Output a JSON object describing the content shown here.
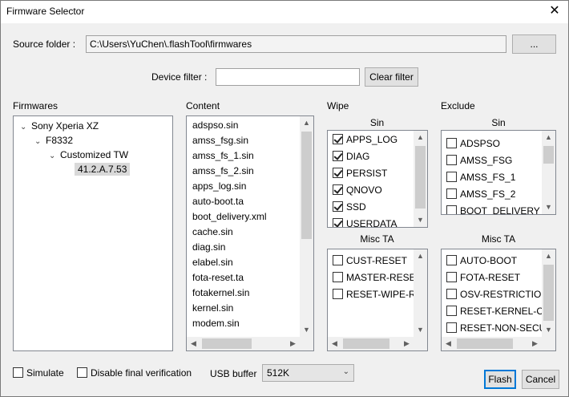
{
  "window": {
    "title": "Firmware Selector",
    "close_glyph": "✕"
  },
  "source": {
    "label": "Source folder :",
    "value": "C:\\Users\\YuChen\\.flashTool\\firmwares",
    "browse_label": "..."
  },
  "device_filter": {
    "label": "Device filter :",
    "value": "",
    "clear_label": "Clear filter"
  },
  "firmwares": {
    "label": "Firmwares",
    "tree": [
      {
        "label": "Sony Xperia XZ"
      },
      {
        "label": "F8332"
      },
      {
        "label": "Customized TW"
      },
      {
        "label": "41.2.A.7.53"
      }
    ]
  },
  "content": {
    "label": "Content",
    "items": [
      "adspso.sin",
      "amss_fsg.sin",
      "amss_fs_1.sin",
      "amss_fs_2.sin",
      "apps_log.sin",
      "auto-boot.ta",
      "boot_delivery.xml",
      "cache.sin",
      "diag.sin",
      "elabel.sin",
      "fota-reset.ta",
      "fotakernel.sin",
      "kernel.sin",
      "modem.sin"
    ]
  },
  "wipe": {
    "label": "Wipe",
    "sin_label": "Sin",
    "sin_items": [
      {
        "label": "APPS_LOG",
        "checked": true
      },
      {
        "label": "DIAG",
        "checked": true
      },
      {
        "label": "PERSIST",
        "checked": true
      },
      {
        "label": "QNOVO",
        "checked": true
      },
      {
        "label": "SSD",
        "checked": true
      },
      {
        "label": "USERDATA",
        "checked": true
      }
    ],
    "misc_label": "Misc TA",
    "misc_items": [
      {
        "label": "CUST-RESET",
        "checked": false
      },
      {
        "label": "MASTER-RESET",
        "checked": false
      },
      {
        "label": "RESET-WIPE-REAS",
        "checked": false
      }
    ]
  },
  "exclude": {
    "label": "Exclude",
    "sin_label": "Sin",
    "sin_items": [
      {
        "label": "ADSPSO",
        "checked": false
      },
      {
        "label": "AMSS_FSG",
        "checked": false
      },
      {
        "label": "AMSS_FS_1",
        "checked": false
      },
      {
        "label": "AMSS_FS_2",
        "checked": false
      },
      {
        "label": "BOOT_DELIVERY",
        "checked": false
      }
    ],
    "misc_label": "Misc TA",
    "misc_items": [
      {
        "label": "AUTO-BOOT",
        "checked": false
      },
      {
        "label": "FOTA-RESET",
        "checked": false
      },
      {
        "label": "OSV-RESTRICTION",
        "checked": false
      },
      {
        "label": "RESET-KERNEL-CM",
        "checked": false
      },
      {
        "label": "RESET-NON-SECU",
        "checked": false
      }
    ]
  },
  "options": {
    "simulate_label": "Simulate",
    "disable_verification_label": "Disable final verification",
    "usb_buffer_label": "USB buffer",
    "usb_buffer_value": "512K"
  },
  "actions": {
    "flash_label": "Flash",
    "cancel_label": "Cancel"
  }
}
